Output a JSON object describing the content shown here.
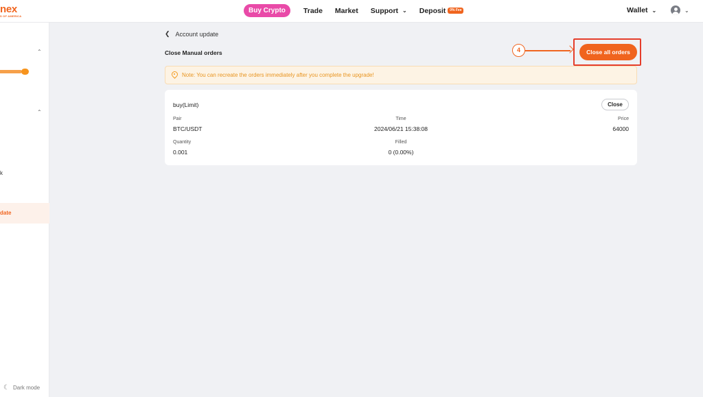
{
  "header": {
    "logo_text": "nex",
    "logo_subtext": "S OF AMERICA",
    "nav": {
      "buy_crypto": "Buy Crypto",
      "trade": "Trade",
      "market": "Market",
      "support": "Support",
      "deposit": "Deposit",
      "deposit_badge": "0% Fee"
    },
    "wallet": "Wallet"
  },
  "sidebar": {
    "partial_item_k": "k",
    "active_item": "date",
    "dark_mode": "Dark mode"
  },
  "page": {
    "breadcrumb": "Account update",
    "title": "Close Manual orders",
    "close_all_label": "Close all orders",
    "annotation_step": "4",
    "notice": "Note: You can recreate the orders immediately after you complete the upgrade!"
  },
  "order": {
    "type": "buy(Limit)",
    "close_label": "Close",
    "pair_label": "Pair",
    "pair": "BTC/USDT",
    "time_label": "Time",
    "time": "2024/06/21 15:38:08",
    "price_label": "Price",
    "price": "64000",
    "quantity_label": "Quantity",
    "quantity": "0.001",
    "filled_label": "Filled",
    "filled": "0 (0.00%)"
  },
  "colors": {
    "accent": "#f0641e",
    "buy_pill": "#e94aa8",
    "annotation_outline": "#e53d2a",
    "notice_bg": "#fdf3e4",
    "notice_text": "#e8941f"
  },
  "icons": {
    "back": "chevron-left-icon",
    "notice": "pin-icon",
    "user": "user-avatar-icon",
    "dark_mode": "moon-icon"
  }
}
